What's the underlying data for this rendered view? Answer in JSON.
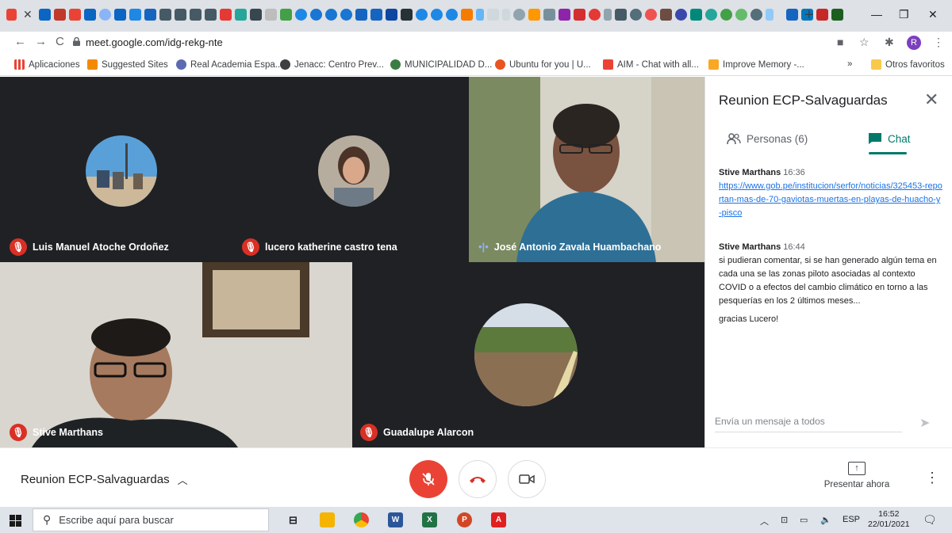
{
  "browser": {
    "url": "meet.google.com/idg-rekg-nte",
    "profile_initial": "R",
    "bookmarks": [
      {
        "label": "Aplicaciones",
        "icon": "apps-grid-icon",
        "color": "#ea4335"
      },
      {
        "label": "Suggested Sites",
        "icon": "suggested-sites-icon",
        "color": "#f28b00"
      },
      {
        "label": "Real Academia Espa...",
        "icon": "rae-icon",
        "color": "#5b6ab2"
      },
      {
        "label": "Jenacc: Centro Prev...",
        "icon": "globe-icon",
        "color": "#3c4043"
      },
      {
        "label": "MUNICIPALIDAD D...",
        "icon": "municipalidad-icon",
        "color": "#3a7d44"
      },
      {
        "label": "Ubuntu for you | U...",
        "icon": "ubuntu-icon",
        "color": "#e95420"
      },
      {
        "label": "AIM - Chat with all...",
        "icon": "aim-icon",
        "color": "#ea4335"
      },
      {
        "label": "Improve Memory -...",
        "icon": "improve-memory-icon",
        "color": "#f9a825"
      }
    ],
    "bookmarks_overflow": "»",
    "other_bookmarks": "Otros favoritos"
  },
  "participants": [
    {
      "name": "Luis Manuel Atoche Ordoñez",
      "muted": true
    },
    {
      "name": "lucero katherine castro tena",
      "muted": true
    },
    {
      "name": "José Antonio Zavala Huambachano",
      "muted": false
    },
    {
      "name": "Stive Marthans",
      "muted": true
    },
    {
      "name": "Guadalupe Alarcon",
      "muted": true
    }
  ],
  "panel": {
    "title": "Reunion ECP-Salvaguardas",
    "tab_people": "Personas (6)",
    "tab_chat": "Chat",
    "messages": [
      {
        "sender": "Stive Marthans",
        "time": "16:36",
        "link": "https://www.gob.pe/institucion/serfor/noticias/325453-reportan-mas-de-70-gaviotas-muertas-en-playas-de-huacho-y-pisco"
      },
      {
        "sender": "Stive Marthans",
        "time": "16:44",
        "text1": "si pudieran comentar, si se han generado algún tema en cada una se las zonas piloto asociadas al contexto COVID o a efectos del cambio climático en torno a las pesquerías en los 2 últimos meses...",
        "text2": "gracias Lucero!"
      }
    ],
    "compose_placeholder": "Envía un mensaje a todos"
  },
  "controls": {
    "meeting_name": "Reunion ECP-Salvaguardas",
    "present_label": "Presentar ahora",
    "mic_color": "#ea4335",
    "hangup_color": "#d93025"
  },
  "taskbar": {
    "search_placeholder": "Escribe aquí para buscar",
    "language": "ESP",
    "time": "16:52",
    "date": "22/01/2021"
  }
}
